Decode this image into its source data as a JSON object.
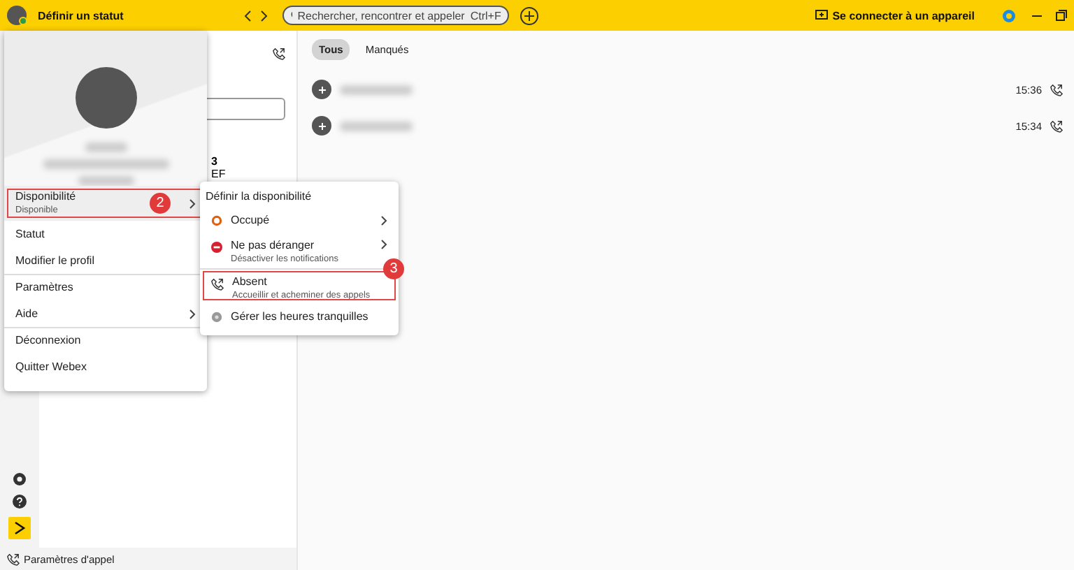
{
  "title_bar": {
    "status_label": "Définir un statut",
    "search": {
      "placeholder": "Rechercher, rencontrer et appeler",
      "shortcut": "Ctrl+F"
    },
    "connect_device": "Se connecter à un appareil"
  },
  "middle_panel": {
    "stat_value": "3",
    "stat_label": "EF"
  },
  "profile_menu": {
    "items": [
      {
        "label": "Disponibilité",
        "sublabel": "Disponible",
        "has_submenu": true,
        "divider_before": false,
        "selected": true,
        "callout": "2"
      },
      {
        "label": "Statut",
        "has_submenu": false,
        "divider_before": false,
        "selected": false
      },
      {
        "label": "Modifier le profil",
        "has_submenu": false,
        "divider_before": false,
        "selected": false
      },
      {
        "label": "Paramètres",
        "has_submenu": false,
        "divider_before": true,
        "selected": false
      },
      {
        "label": "Aide",
        "has_submenu": true,
        "divider_before": false,
        "selected": false
      },
      {
        "label": "Déconnexion",
        "has_submenu": false,
        "divider_before": true,
        "selected": false
      },
      {
        "label": "Quitter Webex",
        "has_submenu": false,
        "divider_before": false,
        "selected": false
      }
    ]
  },
  "availability_menu": {
    "title": "Définir la disponibilité",
    "items": [
      {
        "kind": "busy",
        "label": "Occupé",
        "has_submenu": true,
        "divider_before": false
      },
      {
        "kind": "dnd",
        "label": "Ne pas déranger",
        "sublabel": "Désactiver les notifications",
        "has_submenu": true,
        "divider_before": false
      },
      {
        "kind": "away",
        "label": "Absent",
        "sublabel": "Accueillir et acheminer des appels",
        "has_submenu": false,
        "divider_before": true,
        "callout": "3"
      },
      {
        "kind": "quiet",
        "label": "Gérer les heures tranquilles",
        "has_submenu": false,
        "divider_before": false
      }
    ]
  },
  "tabs": [
    {
      "label": "Tous",
      "selected": true
    },
    {
      "label": "Manqués",
      "selected": false
    }
  ],
  "calls": [
    {
      "time": "15:36"
    },
    {
      "time": "15:34"
    }
  ],
  "footer": {
    "call_settings": "Paramètres d'appel"
  }
}
